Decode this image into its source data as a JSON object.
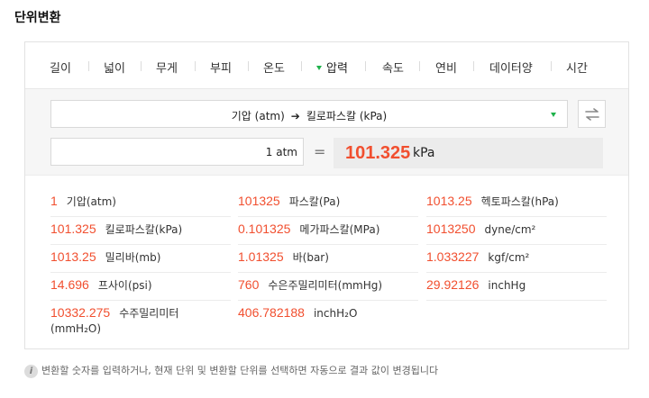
{
  "title": "단위변환",
  "tabs": [
    "길이",
    "넓이",
    "무게",
    "부피",
    "온도",
    "압력",
    "속도",
    "연비",
    "데이터양",
    "시간"
  ],
  "active_tab": "압력",
  "selector": {
    "from": "기압 (atm)",
    "arrow": "➔",
    "to": "킬로파스칼 (kPa)"
  },
  "input": {
    "value": "1",
    "unit": "atm"
  },
  "equals": "=",
  "result": {
    "value": "101.325",
    "unit": "kPa"
  },
  "conversions": [
    {
      "num": "1",
      "unit": "기압(atm)"
    },
    {
      "num": "101325",
      "unit": "파스칼(Pa)"
    },
    {
      "num": "1013.25",
      "unit": "헥토파스칼(hPa)"
    },
    {
      "num": "101.325",
      "unit": "킬로파스칼(kPa)"
    },
    {
      "num": "0.101325",
      "unit": "메가파스칼(MPa)"
    },
    {
      "num": "1013250",
      "unit": "dyne/cm²"
    },
    {
      "num": "1013.25",
      "unit": "밀리바(mb)"
    },
    {
      "num": "1.01325",
      "unit": "바(bar)"
    },
    {
      "num": "1.033227",
      "unit": "kgf/cm²"
    },
    {
      "num": "14.696",
      "unit": "프사이(psi)"
    },
    {
      "num": "760",
      "unit": "수은주밀리미터(mmHg)"
    },
    {
      "num": "29.92126",
      "unit": "inchHg"
    },
    {
      "num": "10332.275",
      "unit": "수주밀리미터",
      "unit_line2": "(mmH₂O)"
    },
    {
      "num": "406.782188",
      "unit": "inchH₂O"
    }
  ],
  "note": {
    "icon": "info-icon",
    "text": "변환할 숫자를 입력하거나, 현재 단위 및 변환할 단위를 선택하면 자동으로 결과 값이 변경됩니다"
  },
  "colors": {
    "accent_red": "#f14f2f",
    "accent_green": "#1fb24b"
  }
}
